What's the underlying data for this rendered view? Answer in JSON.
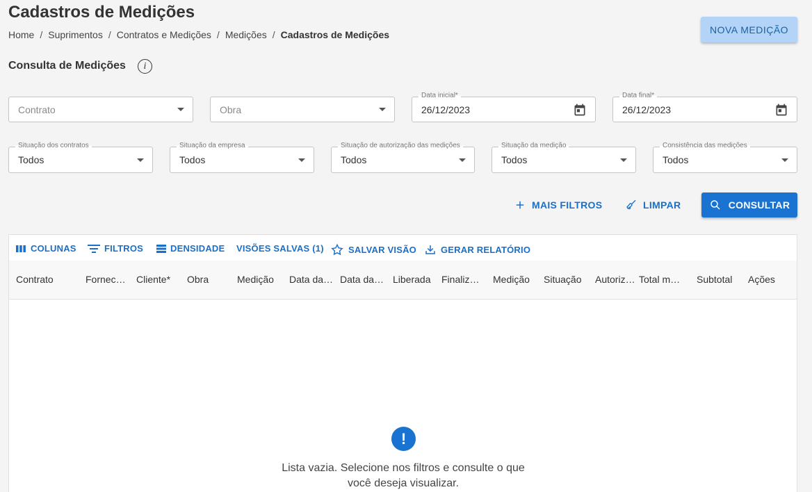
{
  "page": {
    "title": "Cadastros de Medições",
    "breadcrumb": [
      "Home",
      "Suprimentos",
      "Contratos e Medições",
      "Medições",
      "Cadastros de Medições"
    ],
    "new_button": "NOVA MEDIÇÃO"
  },
  "filters": {
    "section_title": "Consulta de Medições",
    "contrato_placeholder": "Contrato",
    "obra_placeholder": "Obra",
    "data_inicial_label": "Data inicial*",
    "data_inicial_value": "26/12/2023",
    "data_final_label": "Data final*",
    "data_final_value": "26/12/2023",
    "selects": [
      {
        "label": "Situação dos contratos",
        "value": "Todos"
      },
      {
        "label": "Situação da empresa",
        "value": "Todos"
      },
      {
        "label": "Situação de autorização das medições",
        "value": "Todos"
      },
      {
        "label": "Situação da medição",
        "value": "Todos"
      },
      {
        "label": "Consistência das medições",
        "value": "Todos"
      }
    ],
    "more_filters": "MAIS FILTROS",
    "clear": "LIMPAR",
    "consult": "CONSULTAR"
  },
  "grid": {
    "toolbar": {
      "columns": "COLUNAS",
      "filters": "FILTROS",
      "density": "DENSIDADE",
      "saved_views": "VISÕES SALVAS (1)",
      "save_view": "SALVAR VISÃO",
      "report": "GERAR RELATÓRIO"
    },
    "columns": [
      "Contrato",
      "Fornecedor",
      "Cliente*",
      "Obra",
      "Medição",
      "Data da medição",
      "Data da liberação",
      "Liberada",
      "Finalizada",
      "Medição",
      "Situação",
      "Autorização",
      "Total medido",
      "Subtotal",
      "Ações"
    ],
    "empty_message_line1": "Lista vazia. Selecione nos filtros e consulte o que",
    "empty_message_line2": "você deseja visualizar."
  },
  "colors": {
    "primary": "#1a73d1",
    "primary_light": "#b3d4f7",
    "background": "#f4f4f4"
  }
}
